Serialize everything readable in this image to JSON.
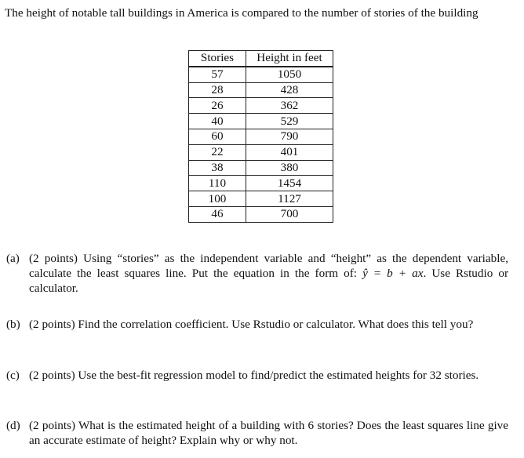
{
  "intro": "The height of notable tall buildings in America is compared to the number of stories of the building",
  "table": {
    "headers": [
      "Stories",
      "Height in feet"
    ],
    "rows": [
      [
        "57",
        "1050"
      ],
      [
        "28",
        "428"
      ],
      [
        "26",
        "362"
      ],
      [
        "40",
        "529"
      ],
      [
        "60",
        "790"
      ],
      [
        "22",
        "401"
      ],
      [
        "38",
        "380"
      ],
      [
        "110",
        "1454"
      ],
      [
        "100",
        "1127"
      ],
      [
        "46",
        "700"
      ]
    ]
  },
  "questions": [
    {
      "label": "(a)",
      "text": "(2 points) Using “stories” as the independent variable and “height” as the dependent variable, calculate the least squares line. Put the equation in the form of: ",
      "equation": "ŷ = b + ax",
      "suffix": ". Use Rstudio or calculator."
    },
    {
      "label": "(b)",
      "text": "(2 points) Find the correlation coefficient. Use Rstudio or calculator. What does this tell you?"
    },
    {
      "label": "(c)",
      "text": "(2 points) Use the best-fit regression model to find/predict the estimated heights for 32 stories."
    },
    {
      "label": "(d)",
      "text": "(2 points) What is the estimated height of a building with 6 stories? Does the least squares line give an accurate estimate of height? Explain why or why not."
    }
  ]
}
